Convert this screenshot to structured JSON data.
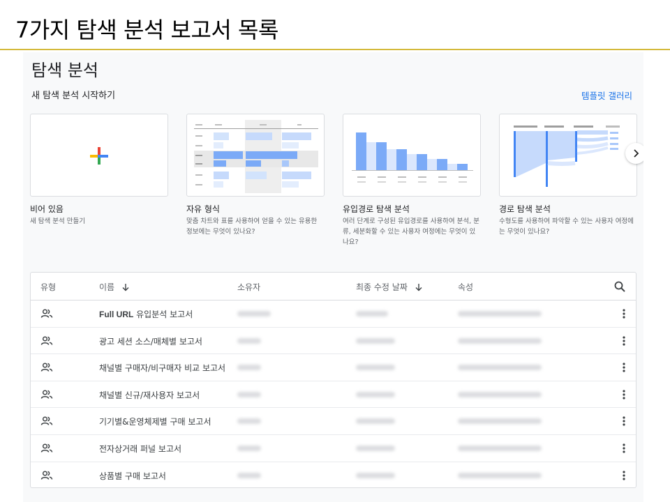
{
  "slide": {
    "title": "7가지 탐색 분석 보고서 목록"
  },
  "explore": {
    "heading": "탐색 분석",
    "subheading": "새 탐색 분석 시작하기",
    "gallery_link": "템플릿 갤러리"
  },
  "templates": [
    {
      "title": "비어 있음",
      "desc": "새 탐색 분석 만들기"
    },
    {
      "title": "자유 형식",
      "desc": "맞춤 차트와 표를 사용하여 얻을 수 있는 유용한 정보에는 무엇이 있나요?"
    },
    {
      "title": "유입경로 탐색 분석",
      "desc": "여러 단계로 구성된 유입경로를 사용하여 분석, 분류, 세분화할 수 있는 사용자 여정에는 무엇이 있나요?"
    },
    {
      "title": "경로 탐색 분석",
      "desc": "수형도를 사용하여 파악할 수 있는 사용자 여정에는 무엇이 있나요?"
    }
  ],
  "colors": {
    "accent_blue": "#1a73e8",
    "chart_blue": "#7baaf7",
    "chart_light": "#c6dafc",
    "plus_red": "#ea4335",
    "plus_yellow": "#fbbc04",
    "plus_green": "#34a853",
    "plus_blue": "#4285f4"
  },
  "table": {
    "headers": {
      "type": "유형",
      "name": "이름",
      "owner": "소유자",
      "modified": "최종 수정 날짜",
      "property": "속성"
    },
    "rows": [
      {
        "name_bold": "Full URL",
        "name": " 유입분석 보고서",
        "owner": "",
        "modified": "",
        "property": ""
      },
      {
        "name_bold": "",
        "name": "광고 세션 소스/매체별 보고서",
        "owner": "",
        "modified": "",
        "property": ""
      },
      {
        "name_bold": "",
        "name": "채널별 구매자/비구매자 비교 보고서",
        "owner": "",
        "modified": "",
        "property": ""
      },
      {
        "name_bold": "",
        "name": "채널별 신규/재사용자 보고서",
        "owner": "",
        "modified": "",
        "property": ""
      },
      {
        "name_bold": "",
        "name": "기기별&운영체제별 구매 보고서",
        "owner": "",
        "modified": "",
        "property": ""
      },
      {
        "name_bold": "",
        "name": "전자상거래 퍼널 보고서",
        "owner": "",
        "modified": "",
        "property": ""
      },
      {
        "name_bold": "",
        "name": "상품별 구매 보고서",
        "owner": "",
        "modified": "",
        "property": ""
      }
    ]
  }
}
